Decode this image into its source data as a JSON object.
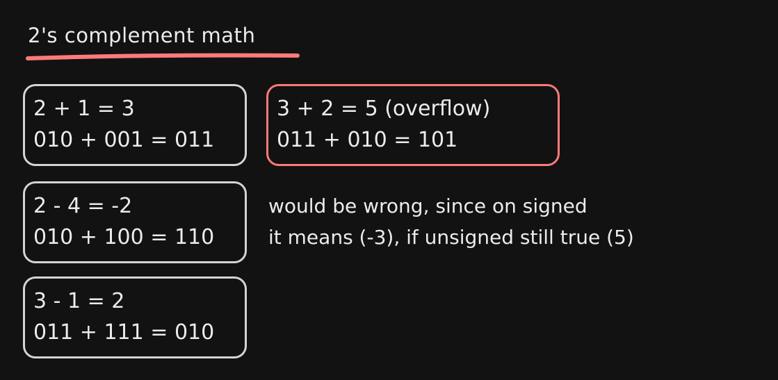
{
  "title": "2's complement math",
  "accent_color": "#ff7a7a",
  "box_color": "#d4d4d4",
  "boxes": [
    {
      "line1": "2 + 1 = 3",
      "line2": "010 + 001 = 011"
    },
    {
      "line1": "3 + 2 = 5 (overflow)",
      "line2": "011 + 010 = 101"
    },
    {
      "line1": "2 - 4 = -2",
      "line2": "010 + 100 = 110"
    },
    {
      "line1": "3 - 1 = 2",
      "line2": "011 + 111 = 010"
    }
  ],
  "note": {
    "line1": "would be wrong, since on signed",
    "line2": "it means (-3), if unsigned still true (5)"
  }
}
